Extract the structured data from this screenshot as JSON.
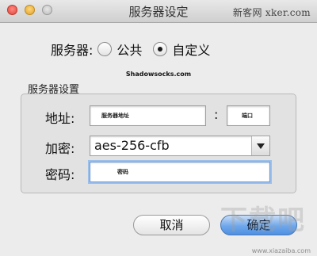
{
  "window": {
    "title": "服务器设定",
    "watermark_top": "新客网 xker.com"
  },
  "server": {
    "label": "服务器:",
    "options": [
      {
        "label": "公共",
        "selected": false
      },
      {
        "label": "自定义",
        "selected": true
      }
    ]
  },
  "brand": "Shadowsocks.com",
  "settings": {
    "group_label": "服务器设置",
    "address": {
      "label": "地址:",
      "value": "服务器地址",
      "colon": ":",
      "port_value": "端口"
    },
    "encryption": {
      "label": "加密:",
      "value": "aes-256-cfb"
    },
    "password": {
      "label": "密码:",
      "value": "密码"
    }
  },
  "buttons": {
    "cancel": "取消",
    "ok": "确定"
  },
  "watermark_bottom": "www.xiazaiba.com",
  "watermark_logo": "下载吧"
}
